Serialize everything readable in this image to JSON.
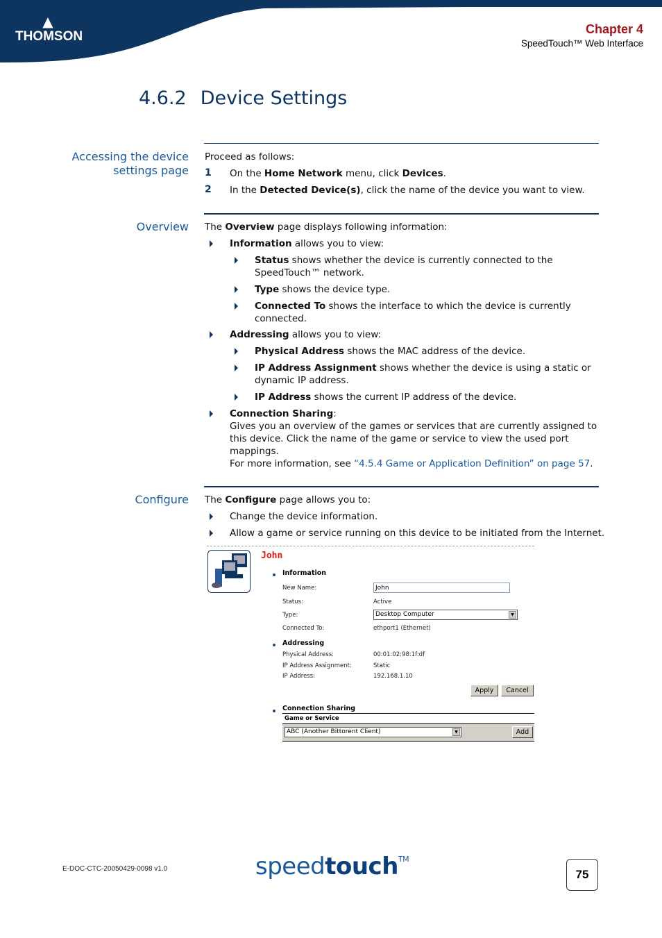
{
  "header": {
    "brand": "THOMSON",
    "chapter": "Chapter 4",
    "subtitle": "SpeedTouch™ Web Interface"
  },
  "section": {
    "number": "4.6.2",
    "title": "Device Settings"
  },
  "accessing": {
    "side_label_line1": "Accessing the device",
    "side_label_line2": "settings page",
    "intro": "Proceed as follows:",
    "steps": [
      {
        "num": "1",
        "pre": "On the ",
        "b1": "Home Network",
        "mid": " menu, click ",
        "b2": "Devices",
        "post": "."
      },
      {
        "num": "2",
        "pre": "In the ",
        "b1": "Detected Device(s)",
        "post": ", click the name of the device you want to view."
      }
    ]
  },
  "overview": {
    "side_label": "Overview",
    "intro_pre": "The ",
    "intro_b": "Overview",
    "intro_post": " page displays following information:",
    "information": {
      "b": "Information",
      "text": " allows you to view:"
    },
    "info_items": [
      {
        "b": "Status",
        "text": " shows whether the device is currently connected to the",
        "text2": "SpeedTouch™ network."
      },
      {
        "b": "Type",
        "text": " shows the device type."
      },
      {
        "b": "Connected To",
        "text": " shows the interface to which the device is currently",
        "text2": "connected."
      }
    ],
    "addressing": {
      "b": "Addressing",
      "text": " allows you to view:"
    },
    "addr_items": [
      {
        "b": "Physical Address",
        "text": " shows the MAC address of the device."
      },
      {
        "b": "IP Address Assignment",
        "text": " shows whether the device is using a static or",
        "text2": "dynamic IP address."
      },
      {
        "b": "IP Address",
        "text": " shows the current IP address of the device."
      }
    ],
    "sharing": {
      "b": "Connection Sharing",
      "colon": ":",
      "line1": "Gives you an overview of the games or services that are currently assigned to",
      "line2": "this device. Click the name of the game or service to view the used port",
      "line3": "mappings.",
      "more_pre": "For more information, see ",
      "more_link": "“4.5.4 Game or Application Definition” on page 57",
      "more_post": "."
    }
  },
  "configure": {
    "side_label": "Configure",
    "intro_pre": "The ",
    "intro_b": "Configure",
    "intro_post": " page allows you to:",
    "items": [
      "Change the device information.",
      "Allow a game or service running on this device to be initiated from the Internet."
    ]
  },
  "screenshot": {
    "device_name": "John",
    "information_heading": "Information",
    "new_name_label": "New Name:",
    "new_name_value": "John",
    "status_label": "Status:",
    "status_value": "Active",
    "type_label": "Type:",
    "type_value": "Desktop Computer",
    "connected_label": "Connected To:",
    "connected_value": "ethport1 (Ethernet)",
    "addressing_heading": "Addressing",
    "phys_label": "Physical Address:",
    "phys_value": "00:01:02:98:1f:df",
    "ipassign_label": "IP Address Assignment:",
    "ipassign_value": "Static",
    "ip_label": "IP Address:",
    "ip_value": "192.168.1.10",
    "apply": "Apply",
    "cancel": "Cancel",
    "sharing_heading": "Connection Sharing",
    "col_header": "Game or Service",
    "game_value": "ABC (Another Bittorent Client)",
    "add": "Add"
  },
  "footer": {
    "doc_id": "E-DOC-CTC-20050429-0098 v1.0",
    "brand_light": "speed",
    "brand_bold": "touch",
    "brand_tm": "TM",
    "page": "75"
  }
}
